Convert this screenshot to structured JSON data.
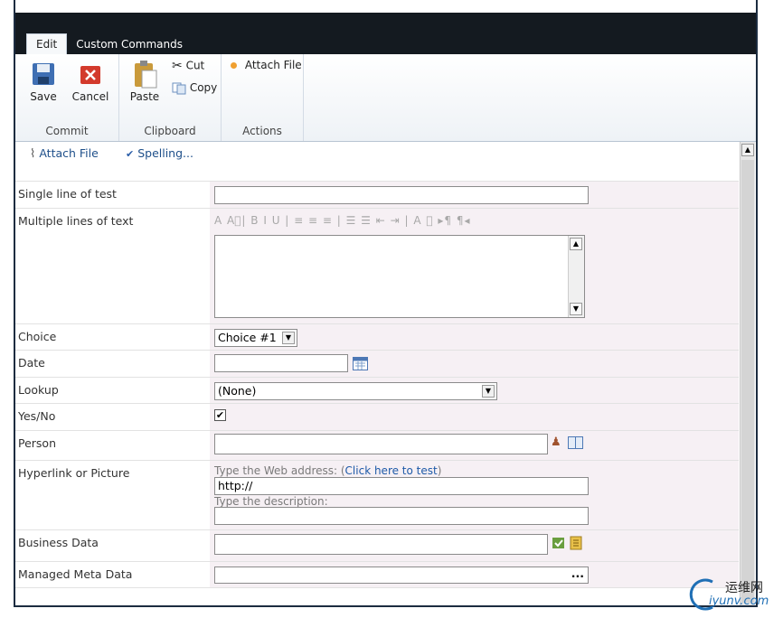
{
  "ribbon": {
    "tabs": [
      {
        "label": "Edit",
        "active": true
      },
      {
        "label": "Custom Commands",
        "active": false
      }
    ],
    "commit": {
      "save": "Save",
      "cancel": "Cancel",
      "group": "Commit"
    },
    "clipboard": {
      "paste": "Paste",
      "cut": "Cut",
      "copy": "Copy",
      "group": "Clipboard"
    },
    "actions": {
      "attach": "Attach File",
      "group": "Actions"
    }
  },
  "toolbar": {
    "attach": "Attach File",
    "spelling": "Spelling..."
  },
  "form": {
    "single_line": {
      "label": "Single line of test",
      "value": ""
    },
    "multi_line": {
      "label": "Multiple lines of text",
      "toolbar_glyphs": "A  A⃞|  B  I  U | ≡ ≡ ≡ | ☰ ☰ ⇤ ⇥ | A  ⧉  ▸¶  ¶◂"
    },
    "choice": {
      "label": "Choice",
      "selected": "Choice #1"
    },
    "date": {
      "label": "Date",
      "value": ""
    },
    "lookup": {
      "label": "Lookup",
      "selected": "(None)"
    },
    "yesno": {
      "label": "Yes/No",
      "checked": true
    },
    "person": {
      "label": "Person",
      "value": ""
    },
    "hyperlink": {
      "label": "Hyperlink or Picture",
      "address_hint": "Type the Web address: (",
      "test_link": "Click here to test",
      "address_hint_end": ")",
      "url_value": "http://",
      "desc_hint": "Type the description:"
    },
    "business": {
      "label": "Business Data",
      "value": ""
    },
    "managed": {
      "label": "Managed Meta Data",
      "ellipsis": "..."
    }
  },
  "watermark": {
    "line1": "运维网",
    "line2": "iyunv.com"
  },
  "colors": {
    "accent_orange": "#f0a030",
    "link_blue": "#1e5aa8",
    "value_bg": "#f6f0f4"
  }
}
